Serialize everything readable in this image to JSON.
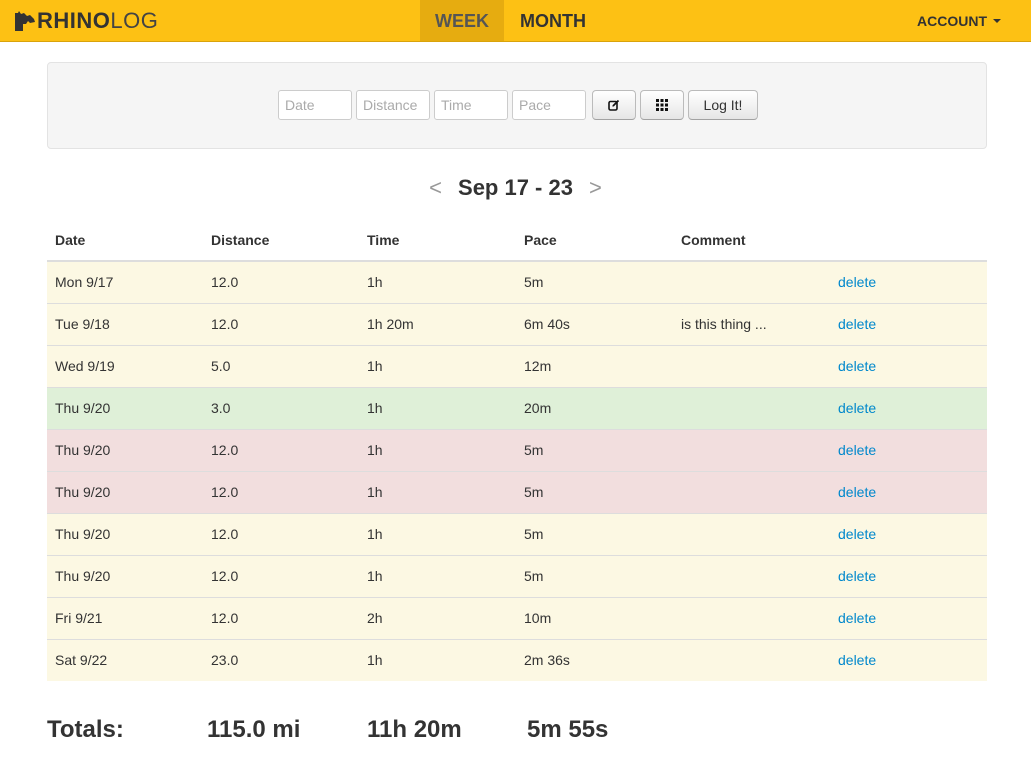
{
  "navbar": {
    "brand_strong": "RHINO",
    "brand_light": "LOG",
    "tabs": [
      {
        "label": "WEEK",
        "active": true
      },
      {
        "label": "MONTH",
        "active": false
      }
    ],
    "account_label": "ACCOUNT",
    "colors": {
      "background": "#fdc114",
      "active_tab": "#e6ac10"
    }
  },
  "form": {
    "date_placeholder": "Date",
    "distance_placeholder": "Distance",
    "time_placeholder": "Time",
    "pace_placeholder": "Pace",
    "edit_icon": "edit-icon",
    "grid_icon": "grid-icon",
    "submit_label": "Log It!"
  },
  "week": {
    "prev_label": "<",
    "range": "Sep 17 - 23",
    "next_label": ">"
  },
  "table": {
    "headers": [
      "Date",
      "Distance",
      "Time",
      "Pace",
      "Comment",
      ""
    ],
    "rows": [
      {
        "date": "Mon 9/17",
        "distance": "12.0",
        "time": "1h",
        "pace": "5m",
        "comment": "",
        "action": "delete",
        "status": "warning"
      },
      {
        "date": "Tue 9/18",
        "distance": "12.0",
        "time": "1h 20m",
        "pace": "6m 40s",
        "comment": "is this thing ...",
        "action": "delete",
        "status": "warning"
      },
      {
        "date": "Wed 9/19",
        "distance": "5.0",
        "time": "1h",
        "pace": "12m",
        "comment": "",
        "action": "delete",
        "status": "warning"
      },
      {
        "date": "Thu 9/20",
        "distance": "3.0",
        "time": "1h",
        "pace": "20m",
        "comment": "",
        "action": "delete",
        "status": "success"
      },
      {
        "date": "Thu 9/20",
        "distance": "12.0",
        "time": "1h",
        "pace": "5m",
        "comment": "",
        "action": "delete",
        "status": "error"
      },
      {
        "date": "Thu 9/20",
        "distance": "12.0",
        "time": "1h",
        "pace": "5m",
        "comment": "",
        "action": "delete",
        "status": "error"
      },
      {
        "date": "Thu 9/20",
        "distance": "12.0",
        "time": "1h",
        "pace": "5m",
        "comment": "",
        "action": "delete",
        "status": "warning"
      },
      {
        "date": "Thu 9/20",
        "distance": "12.0",
        "time": "1h",
        "pace": "5m",
        "comment": "",
        "action": "delete",
        "status": "warning"
      },
      {
        "date": "Fri 9/21",
        "distance": "12.0",
        "time": "2h",
        "pace": "10m",
        "comment": "",
        "action": "delete",
        "status": "warning"
      },
      {
        "date": "Sat 9/22",
        "distance": "23.0",
        "time": "1h",
        "pace": "2m 36s",
        "comment": "",
        "action": "delete",
        "status": "warning"
      }
    ],
    "status_colors": {
      "warning": "#fcf8e3",
      "success": "#dff0d8",
      "error": "#f2dede"
    },
    "link_color": "#0088cc"
  },
  "totals": {
    "label": "Totals:",
    "distance": "115.0 mi",
    "time": "11h 20m",
    "pace": "5m 55s"
  }
}
